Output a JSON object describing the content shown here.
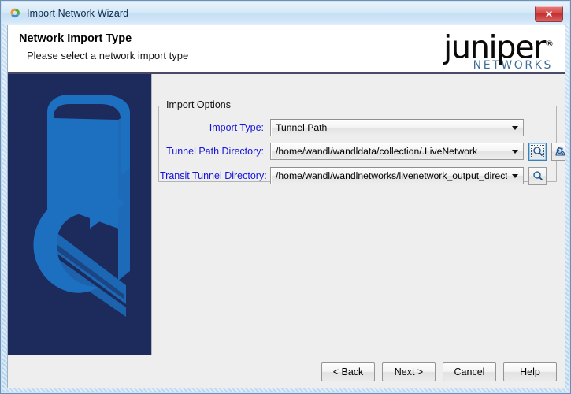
{
  "window": {
    "title": "Import Network Wizard",
    "app_icon": "wandl-swirl-icon",
    "close_label": "✕"
  },
  "banner": {
    "title": "Network Import Type",
    "subtitle": "Please select a network import type",
    "logo_word": "juniper",
    "logo_reg": "®",
    "logo_sub": "NETWORKS"
  },
  "sidebar": {
    "art": "isometric-monitor-refresh-illustration",
    "bg_color": "#1d2a5c",
    "art_color": "#1d70c0"
  },
  "form": {
    "group_legend": "Import Options",
    "rows": [
      {
        "label": "Import Type:",
        "value": "Tunnel Path",
        "name": "import-type"
      },
      {
        "label": "Tunnel Path Directory:",
        "value": "/home/wandl/wandldata/collection/.LiveNetwork",
        "name": "tunnel-path-directory"
      },
      {
        "label": "Transit Tunnel Directory:",
        "value": "/home/wandl/wandlnetworks/livenetwork_output_directory",
        "name": "transit-tunnel-directory"
      }
    ],
    "browse_icon": "magnifier-icon",
    "group_browse_icon": "magnifier-group-icon",
    "label_color": "#1414dc"
  },
  "buttons": {
    "back": "< Back",
    "next": "Next >",
    "cancel": "Cancel",
    "help": "Help"
  }
}
